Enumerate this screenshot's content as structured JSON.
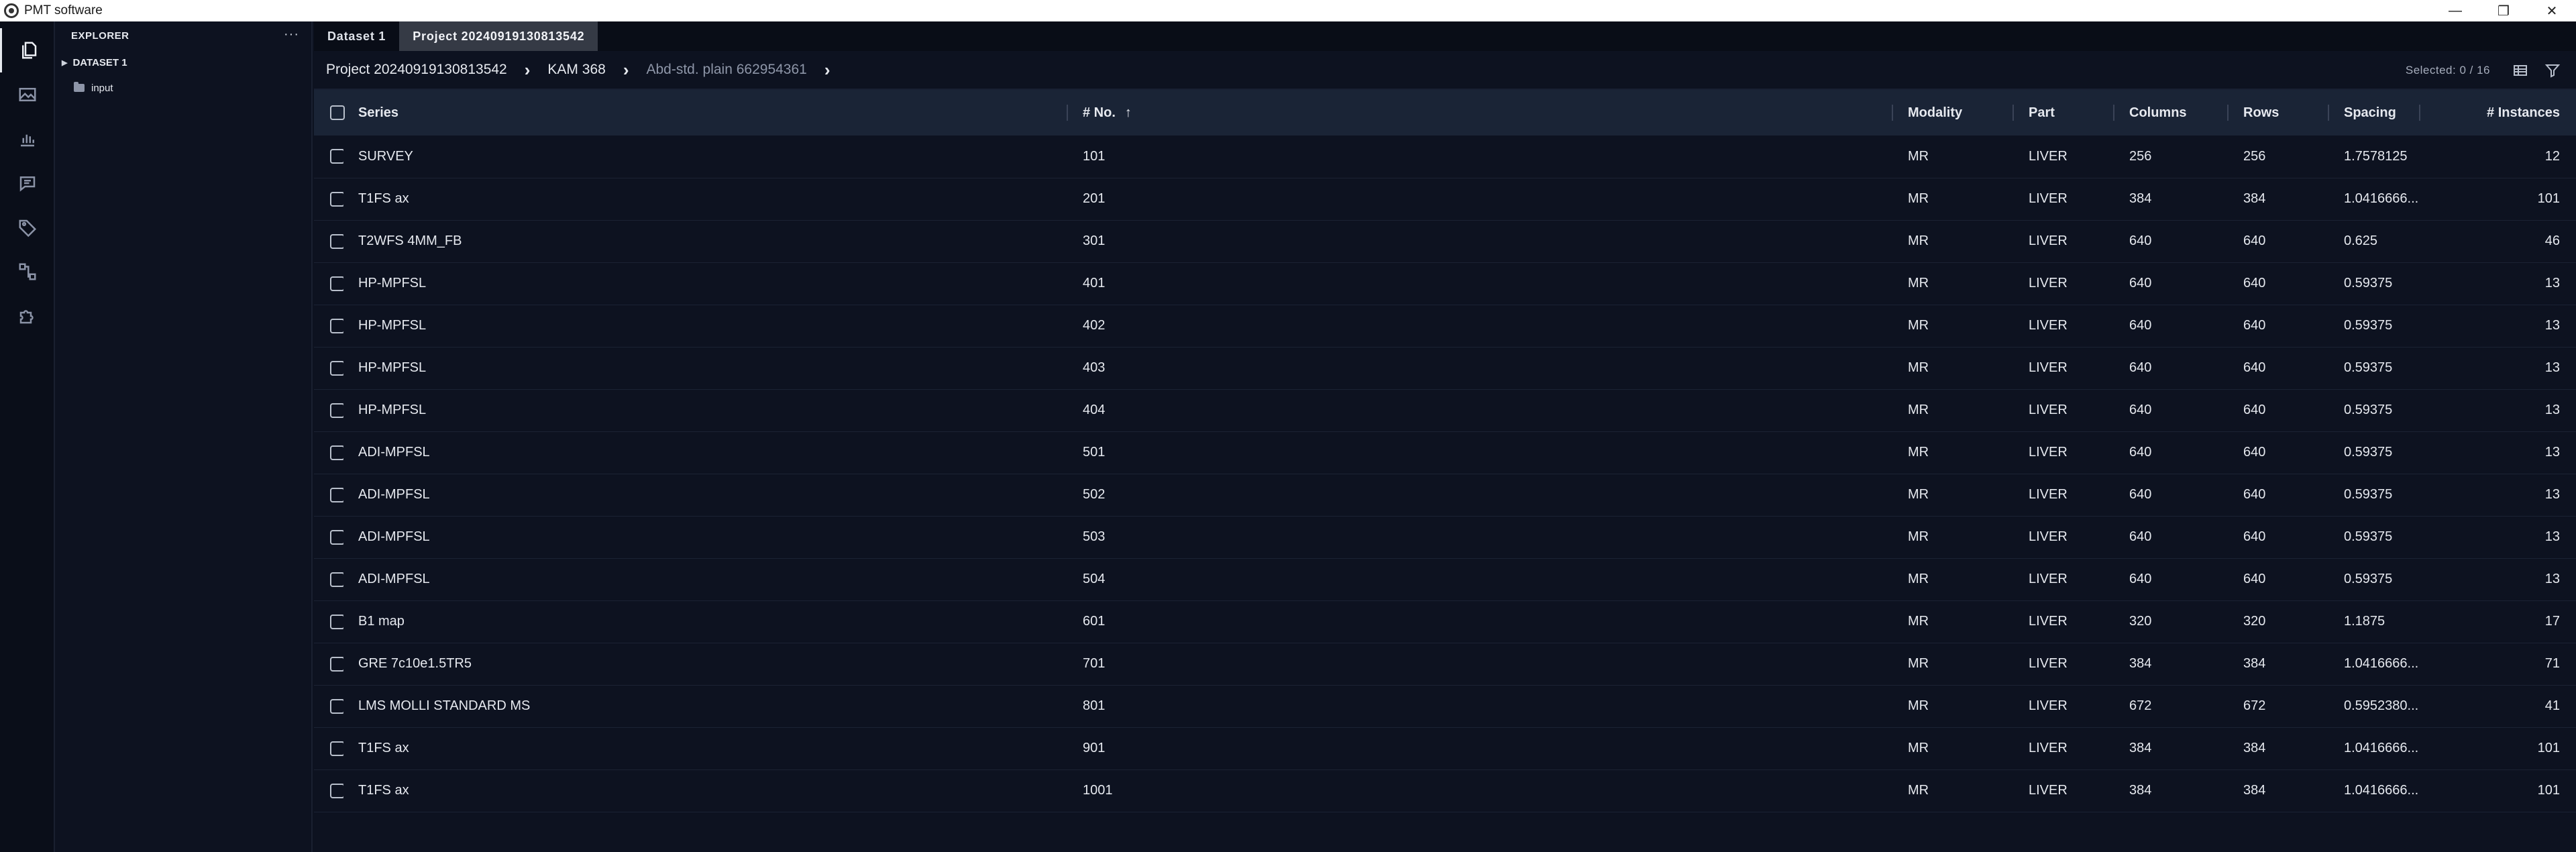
{
  "window": {
    "title": "PMT software",
    "minimize": "—",
    "restore": "❐",
    "close": "✕"
  },
  "explorer": {
    "title": "EXPLORER",
    "more": "···",
    "dataset": "DATASET 1",
    "folder": "input"
  },
  "tabs": [
    "Dataset 1",
    "Project 20240919130813542"
  ],
  "breadcrumb": [
    "Project 20240919130813542",
    "KAM 368",
    "Abd-std. plain 662954361"
  ],
  "selection": "Selected: 0 / 16",
  "columns": [
    "Series",
    "# No.",
    "Modality",
    "Part",
    "Columns",
    "Rows",
    "Spacing",
    "# Instances"
  ],
  "sort_arrow": "↑",
  "rows": [
    {
      "series": "SURVEY",
      "no": "101",
      "modality": "MR",
      "part": "LIVER",
      "columns": "256",
      "rows": "256",
      "spacing": "1.7578125",
      "instances": "12"
    },
    {
      "series": "T1FS ax",
      "no": "201",
      "modality": "MR",
      "part": "LIVER",
      "columns": "384",
      "rows": "384",
      "spacing": "1.0416666...",
      "instances": "101"
    },
    {
      "series": "T2WFS 4MM_FB",
      "no": "301",
      "modality": "MR",
      "part": "LIVER",
      "columns": "640",
      "rows": "640",
      "spacing": "0.625",
      "instances": "46"
    },
    {
      "series": "HP-MPFSL",
      "no": "401",
      "modality": "MR",
      "part": "LIVER",
      "columns": "640",
      "rows": "640",
      "spacing": "0.59375",
      "instances": "13"
    },
    {
      "series": "HP-MPFSL",
      "no": "402",
      "modality": "MR",
      "part": "LIVER",
      "columns": "640",
      "rows": "640",
      "spacing": "0.59375",
      "instances": "13"
    },
    {
      "series": "HP-MPFSL",
      "no": "403",
      "modality": "MR",
      "part": "LIVER",
      "columns": "640",
      "rows": "640",
      "spacing": "0.59375",
      "instances": "13"
    },
    {
      "series": "HP-MPFSL",
      "no": "404",
      "modality": "MR",
      "part": "LIVER",
      "columns": "640",
      "rows": "640",
      "spacing": "0.59375",
      "instances": "13"
    },
    {
      "series": "ADI-MPFSL",
      "no": "501",
      "modality": "MR",
      "part": "LIVER",
      "columns": "640",
      "rows": "640",
      "spacing": "0.59375",
      "instances": "13"
    },
    {
      "series": "ADI-MPFSL",
      "no": "502",
      "modality": "MR",
      "part": "LIVER",
      "columns": "640",
      "rows": "640",
      "spacing": "0.59375",
      "instances": "13"
    },
    {
      "series": "ADI-MPFSL",
      "no": "503",
      "modality": "MR",
      "part": "LIVER",
      "columns": "640",
      "rows": "640",
      "spacing": "0.59375",
      "instances": "13"
    },
    {
      "series": "ADI-MPFSL",
      "no": "504",
      "modality": "MR",
      "part": "LIVER",
      "columns": "640",
      "rows": "640",
      "spacing": "0.59375",
      "instances": "13"
    },
    {
      "series": "B1 map",
      "no": "601",
      "modality": "MR",
      "part": "LIVER",
      "columns": "320",
      "rows": "320",
      "spacing": "1.1875",
      "instances": "17"
    },
    {
      "series": "GRE 7c10e1.5TR5",
      "no": "701",
      "modality": "MR",
      "part": "LIVER",
      "columns": "384",
      "rows": "384",
      "spacing": "1.0416666...",
      "instances": "71"
    },
    {
      "series": "LMS MOLLI STANDARD MS",
      "no": "801",
      "modality": "MR",
      "part": "LIVER",
      "columns": "672",
      "rows": "672",
      "spacing": "0.5952380...",
      "instances": "41"
    },
    {
      "series": "T1FS ax",
      "no": "901",
      "modality": "MR",
      "part": "LIVER",
      "columns": "384",
      "rows": "384",
      "spacing": "1.0416666...",
      "instances": "101"
    },
    {
      "series": "T1FS ax",
      "no": "1001",
      "modality": "MR",
      "part": "LIVER",
      "columns": "384",
      "rows": "384",
      "spacing": "1.0416666...",
      "instances": "101"
    }
  ],
  "icons": {
    "activity": [
      "files-icon",
      "image-icon",
      "bar-chart-icon",
      "comments-icon",
      "tag-icon",
      "workflow-icon",
      "extensions-icon"
    ],
    "toolbar": [
      "table-view-icon",
      "filter-icon"
    ]
  }
}
